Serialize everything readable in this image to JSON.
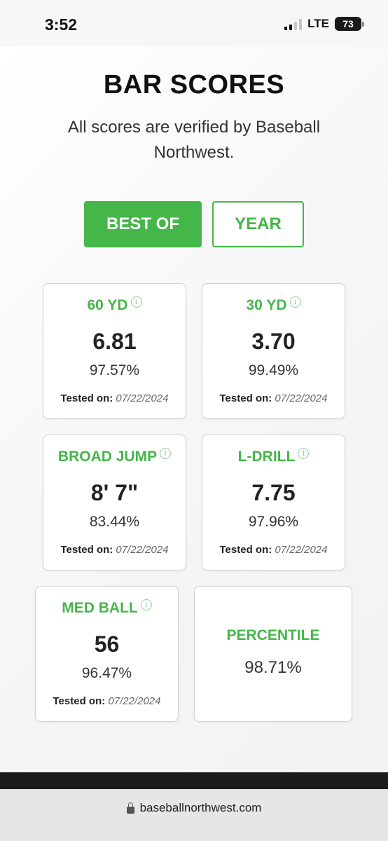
{
  "status_bar": {
    "time": "3:52",
    "network": "LTE",
    "battery": "73"
  },
  "page": {
    "title": "BAR SCORES",
    "subtitle": "All scores are verified by Baseball Northwest."
  },
  "toggles": {
    "best_of": "BEST OF",
    "year": "YEAR",
    "selected": "BEST OF"
  },
  "colors": {
    "accent": "#45b649",
    "info_icon": "#8fd092"
  },
  "cards": [
    {
      "title": "60 YD",
      "value": "6.81",
      "percentile": "97.57%",
      "tested_label": "Tested on:",
      "tested_date": "07/22/2024"
    },
    {
      "title": "30 YD",
      "value": "3.70",
      "percentile": "99.49%",
      "tested_label": "Tested on:",
      "tested_date": "07/22/2024"
    },
    {
      "title": "BROAD JUMP",
      "value": "8' 7\"",
      "percentile": "83.44%",
      "tested_label": "Tested on:",
      "tested_date": "07/22/2024"
    },
    {
      "title": "L-DRILL",
      "value": "7.75",
      "percentile": "97.96%",
      "tested_label": "Tested on:",
      "tested_date": "07/22/2024"
    },
    {
      "title": "MED BALL",
      "value": "56",
      "percentile": "96.47%",
      "tested_label": "Tested on:",
      "tested_date": "07/22/2024"
    }
  ],
  "percentile_card": {
    "title": "PERCENTILE",
    "value": "98.71%"
  },
  "icons": {
    "info": "info-icon",
    "lock": "lock-icon"
  },
  "browser": {
    "url": "baseballnorthwest.com"
  }
}
